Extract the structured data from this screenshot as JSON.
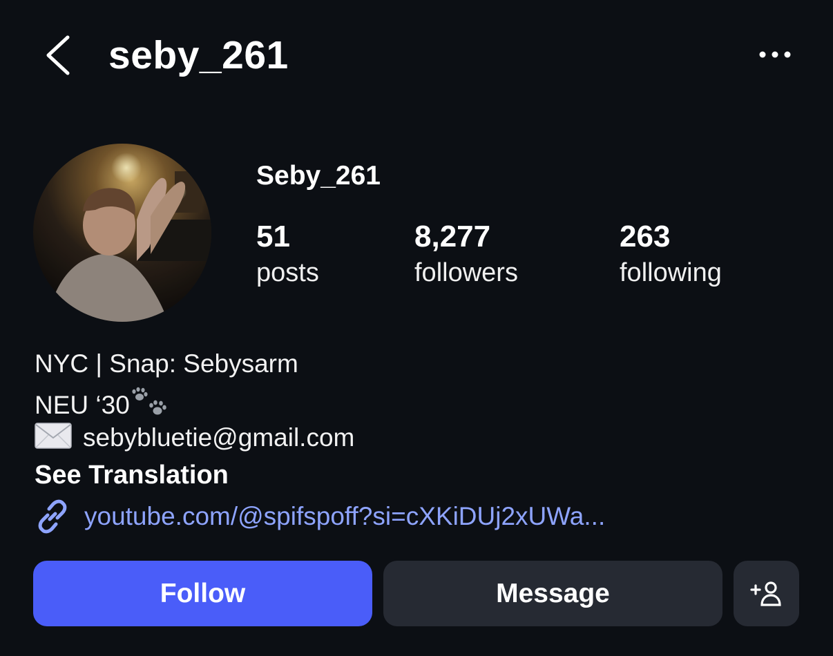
{
  "header": {
    "title": "seby_261"
  },
  "profile": {
    "name": "Seby_261",
    "stats": [
      {
        "value": "51",
        "label": "posts"
      },
      {
        "value": "8,277",
        "label": "followers"
      },
      {
        "value": "263",
        "label": "following"
      }
    ],
    "bio": {
      "line1": "NYC | Snap: Sebysarm",
      "line2": "NEU ‘30",
      "email": "sebybluetie@gmail.com"
    },
    "see_translation": "See Translation",
    "link": "youtube.com/@spifspoff?si=cXKiDUj2xUWa..."
  },
  "actions": {
    "follow_label": "Follow",
    "message_label": "Message"
  },
  "icons": {
    "back": "chevron-left-icon",
    "more": "more-horizontal-icon",
    "paw": "paw-prints-icon",
    "mail": "envelope-icon",
    "link": "link-icon",
    "add_person": "add-person-icon"
  },
  "colors": {
    "background": "#0c0f14",
    "follow_button": "#4a5df9",
    "secondary_button": "#262a33",
    "link": "#8ea4ff"
  }
}
